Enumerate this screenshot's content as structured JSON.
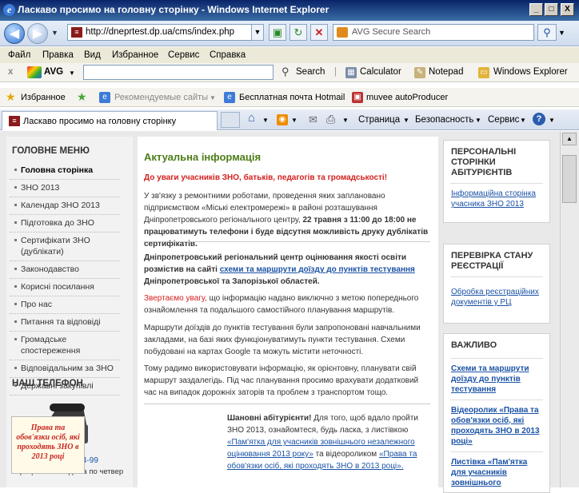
{
  "window": {
    "title": "Ласкаво просимо на головну сторінку - Windows Internet Explorer",
    "min": "_",
    "max": "□",
    "close": "X"
  },
  "address": {
    "url": "http://dneprtest.dp.ua/cms/index.php",
    "search_placeholder": "AVG Secure Search"
  },
  "menu": [
    "Файл",
    "Правка",
    "Вид",
    "Избранное",
    "Сервис",
    "Справка"
  ],
  "avg": {
    "close": "x",
    "brand": "AVG",
    "search": "Search",
    "calculator": "Calculator",
    "notepad": "Notepad",
    "explorer": "Windows Explorer"
  },
  "favorites": {
    "label": "Избранное",
    "item1": "Рекомендуемые сайты",
    "item2": "Бесплатная почта Hotmail",
    "item3": "muvee autoProducer"
  },
  "tab": {
    "title": "Ласкаво просимо на головну сторінку",
    "page": "Страница",
    "security": "Безопасность",
    "service": "Сервис"
  },
  "left": {
    "menu_title": "ГОЛОВНЕ МЕНЮ",
    "items": [
      "Головна сторінка",
      "ЗНО 2013",
      "Календар ЗНО 2013",
      "Підготовка до ЗНО",
      "Сертифікати ЗНО (дублікати)",
      "Законодавство",
      "Корисні посилання",
      "Про нас",
      "Питання та відповіді",
      "Громадське спостереження",
      "Відповідальним за ЗНО",
      "Державні закупівлі"
    ],
    "phone_title": "НАШ ТЕЛЕФОН",
    "phone": "056-790-24-99",
    "hours": "Працює: з понеділка по четвер"
  },
  "main": {
    "title": "Актуальна інформація",
    "notice": "До уваги учасників ЗНО, батьків, педагогів та громадськості!",
    "p1": "У зв'язку з ремонтними роботами, проведення яких заплановано підприємством «Міські електромережі» в районі розташування Дніпропетровського регіонального центру,",
    "p1_bold": "22 травня з 11:00 до 18:00 не працюватимуть телефони і буде відсутня можливість друку дублікатів сертифікатів.",
    "p2a": "Дніпропетровський регіональний центр оцінювання якості освіти розмістив на сайті",
    "p2_link": "схеми та маршрути доїзду до пунктів тестування",
    "p2b": "Дніпропетровської та Запорізької областей.",
    "p3_red": "Звертаємо увагу,",
    "p3": "що інформацію надано виключно з метою попереднього ознайомлення та подальшого самостійного планування маршрутів.",
    "p4": "Маршрути доїздів до пунктів тестування були запропоновані навчальними закладами, на базі яких функціонуватимуть пункти тестування. Схеми побудовані на картах Google та можуть містити неточності.",
    "p5": "Тому радимо використовувати інформацію, як орієнтовну, планувати свій маршрут заздалегідь. Під час планування просимо врахувати додатковий час на випадок дорожніх заторів та проблем з транспортом тощо.",
    "promo_img": "Права та обов'язки осіб, які проходять ЗНО в 2013 році",
    "p6_bold": "Шановні абітурієнти!",
    "p6": "Для того, щоб вдало пройти ЗНО 2013, ознайомтеся, будь ласка, з листівкою",
    "p6_link1": "«Пам'ятка для учасників зовнішнього незалежного оцінювання 2013 року»",
    "p6_mid": "та відеороликом",
    "p6_link2": "«Права та обов'язки осіб, які проходять ЗНО в 2013 році»."
  },
  "right": {
    "box1_title": "ПЕРСОНАЛЬНІ СТОРІНКИ АБІТУРІЄНТІВ",
    "box1_link": "Інформаційна сторінка учасника ЗНО 2013",
    "box2_title": "ПЕРЕВІРКА СТАНУ РЕЄСТРАЦІЇ",
    "box2_link": "Обробка реєстраційних документів у РЦ",
    "box3_title": "ВАЖЛИВО",
    "box3_link1": "Схеми та маршрути доїзду до пунктів тестування",
    "box3_link2": "Відеоролик «Права та обов'язки осіб, які проходять ЗНО в 2013 році»",
    "box3_link3": "Листівка «Пам'ятка для учасників зовнішнього"
  },
  "colors": {
    "accent_green": "#4e7d17",
    "alert_red": "#d3201d",
    "link_blue": "#1a52a5"
  }
}
